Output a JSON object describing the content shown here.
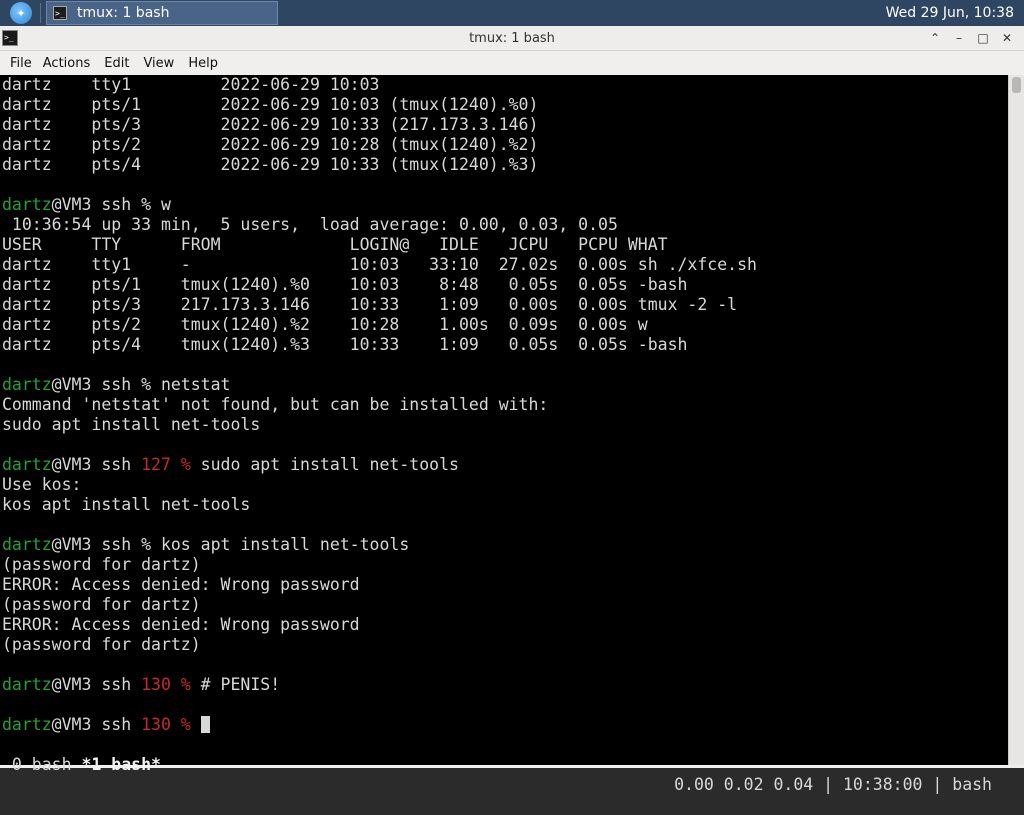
{
  "panel": {
    "task_title": "tmux: 1 bash",
    "clock": "Wed 29 Jun, 10:38"
  },
  "window": {
    "title": "tmux: 1 bash",
    "menu": [
      "File",
      "Actions",
      "Edit",
      "View",
      "Help"
    ]
  },
  "terminal": {
    "lines": [
      [
        {
          "t": "dartz    tty1         2022-06-29 10:03"
        }
      ],
      [
        {
          "t": "dartz    pts/1        2022-06-29 10:03 (tmux(1240).%0)"
        }
      ],
      [
        {
          "t": "dartz    pts/3        2022-06-29 10:33 (217.173.3.146)"
        }
      ],
      [
        {
          "t": "dartz    pts/2        2022-06-29 10:28 (tmux(1240).%2)"
        }
      ],
      [
        {
          "t": "dartz    pts/4        2022-06-29 10:33 (tmux(1240).%3)"
        }
      ],
      [],
      [
        {
          "t": "dartz",
          "c": "g"
        },
        {
          "t": "@VM3 ssh % w"
        }
      ],
      [
        {
          "t": " 10:36:54 up 33 min,  5 users,  load average: 0.00, 0.03, 0.05"
        }
      ],
      [
        {
          "t": "USER     TTY      FROM             LOGIN@   IDLE   JCPU   PCPU WHAT"
        }
      ],
      [
        {
          "t": "dartz    tty1     -                10:03   33:10  27.02s  0.00s sh ./xfce.sh"
        }
      ],
      [
        {
          "t": "dartz    pts/1    tmux(1240).%0    10:03    8:48   0.05s  0.05s -bash"
        }
      ],
      [
        {
          "t": "dartz    pts/3    217.173.3.146    10:33    1:09   0.00s  0.00s tmux -2 -l"
        }
      ],
      [
        {
          "t": "dartz    pts/2    tmux(1240).%2    10:28    1.00s  0.09s  0.00s w"
        }
      ],
      [
        {
          "t": "dartz    pts/4    tmux(1240).%3    10:33    1:09   0.05s  0.05s -bash"
        }
      ],
      [],
      [
        {
          "t": "dartz",
          "c": "g"
        },
        {
          "t": "@VM3 ssh % netstat"
        }
      ],
      [
        {
          "t": "Command 'netstat' not found, but can be installed with:"
        }
      ],
      [
        {
          "t": "sudo apt install net-tools"
        }
      ],
      [],
      [
        {
          "t": "dartz",
          "c": "g"
        },
        {
          "t": "@VM3 ssh "
        },
        {
          "t": "127 %",
          "c": "r"
        },
        {
          "t": " sudo apt install net-tools"
        }
      ],
      [
        {
          "t": "Use kos:"
        }
      ],
      [
        {
          "t": "kos apt install net-tools"
        }
      ],
      [],
      [
        {
          "t": "dartz",
          "c": "g"
        },
        {
          "t": "@VM3 ssh % kos apt install net-tools"
        }
      ],
      [
        {
          "t": "(password for dartz)"
        }
      ],
      [
        {
          "t": "ERROR: Access denied: Wrong password"
        }
      ],
      [
        {
          "t": "(password for dartz)"
        }
      ],
      [
        {
          "t": "ERROR: Access denied: Wrong password"
        }
      ],
      [
        {
          "t": "(password for dartz)"
        }
      ],
      [],
      [
        {
          "t": "dartz",
          "c": "g"
        },
        {
          "t": "@VM3 ssh "
        },
        {
          "t": "130 %",
          "c": "r"
        },
        {
          "t": " # PENIS!"
        }
      ],
      [],
      [
        {
          "t": "dartz",
          "c": "g"
        },
        {
          "t": "@VM3 ssh "
        },
        {
          "t": "130 %",
          "c": "r"
        },
        {
          "t": " "
        },
        {
          "cursor": true
        }
      ]
    ],
    "status_left_window0": " 0 bash ",
    "status_left_window1": "*1 bash*",
    "status_right": "0.00 0.02 0.04 | 10:38:00 | bash"
  }
}
